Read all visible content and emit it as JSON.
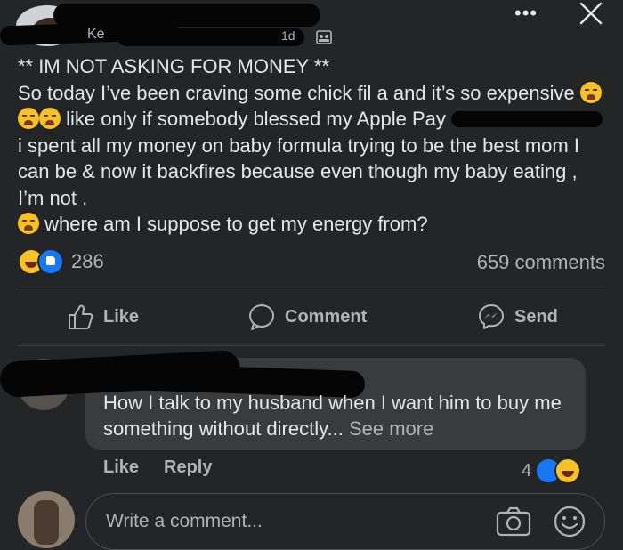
{
  "header": {
    "name_fragment": "Ke",
    "time_fragment": "1d",
    "more_icon": "more-horizontal-icon",
    "close_icon": "close-icon"
  },
  "post": {
    "line1": "** IM NOT ASKING FOR MONEY **",
    "text_a": "So today I’ve been craving some chick fil a and it’s so expensive",
    "text_b": "like only if somebody blessed my Apple Pay",
    "text_c": "i spent all my money on baby formula trying to be the best mom I can be & now it backfires because even though my baby eating , I’m not .",
    "text_d": "where am I suppose to get my energy from?"
  },
  "stats": {
    "reaction_count": "286",
    "comments_label": "659 comments"
  },
  "actions": {
    "like": "Like",
    "comment": "Comment",
    "send": "Send"
  },
  "comment": {
    "text": "How I talk to my husband when I want him to buy me something without directly...",
    "see_more": "See more",
    "like": "Like",
    "reply": "Reply",
    "reaction_count": "4"
  },
  "composer": {
    "placeholder": "Write a comment..."
  },
  "colors": {
    "background": "#242526",
    "bubble": "#3a3b3c",
    "text": "#e4e6eb",
    "secondary": "#b0b3b8",
    "like_blue": "#1877f2",
    "emoji_yellow": "#f6c227"
  }
}
